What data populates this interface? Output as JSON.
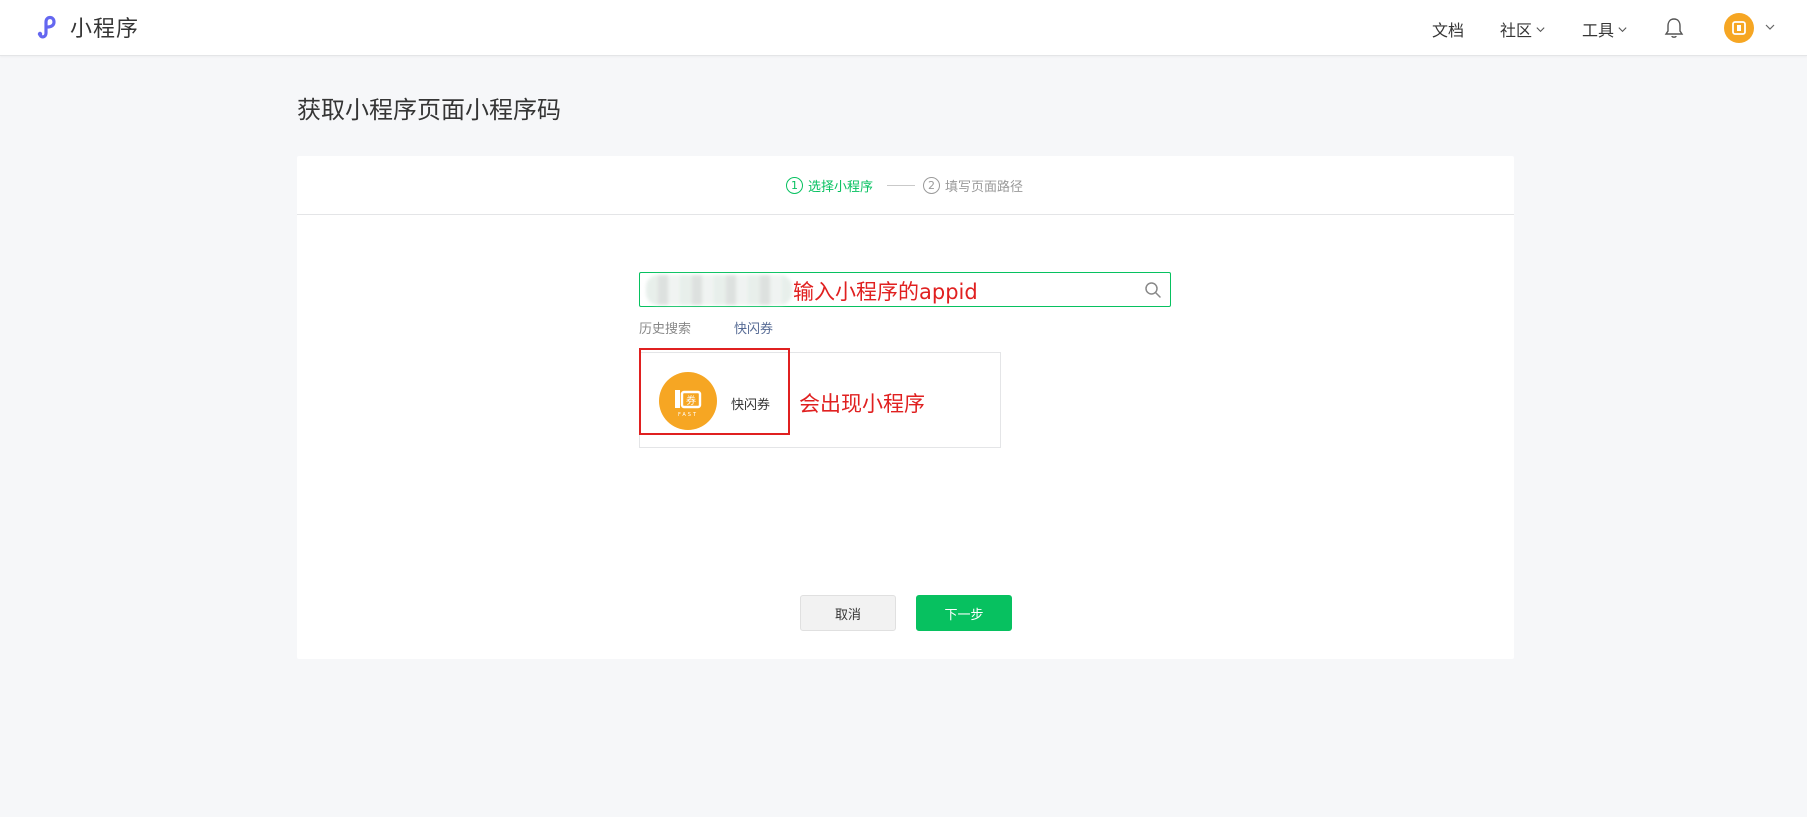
{
  "header": {
    "logo_text": "小程序",
    "nav": {
      "docs": "文档",
      "community": "社区",
      "tools": "工具"
    }
  },
  "page": {
    "title": "获取小程序页面小程序码"
  },
  "steps": [
    {
      "number": "1",
      "label": "选择小程序",
      "state": "active"
    },
    {
      "number": "2",
      "label": "填写页面路径",
      "state": "inactive"
    }
  ],
  "search": {
    "value": "",
    "annotation": "输入小程序的appid"
  },
  "history": {
    "label": "历史搜索",
    "items": [
      "快闪券"
    ]
  },
  "results": {
    "items": [
      {
        "name": "快闪券",
        "logo_text": "券",
        "logo_subtext": "FAST"
      }
    ],
    "annotation": "会出现小程序"
  },
  "buttons": {
    "cancel": "取消",
    "next": "下一步"
  },
  "colors": {
    "primary_green": "#07c160",
    "annotation_red": "#e02020",
    "brand_orange": "#f6a623",
    "logo_purple": "#6467f0"
  }
}
